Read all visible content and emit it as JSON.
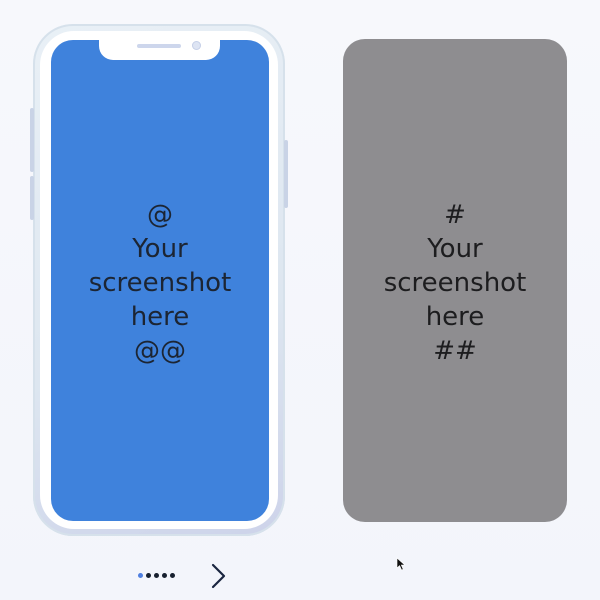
{
  "slides": [
    {
      "lines": [
        "@",
        "Your",
        "screenshot",
        "here",
        "@@"
      ]
    },
    {
      "lines": [
        "#",
        "Your",
        "screenshot",
        "here",
        "##"
      ]
    }
  ],
  "pager": {
    "dot_count": 5,
    "active_index": 0
  },
  "colors": {
    "slide1_bg": "#3f82dc",
    "slide2_bg": "#8e8d90",
    "page_bg": "#f5f7fc",
    "dot": "#17202f",
    "dot_active": "#4f7fe0",
    "arrow": "#1a2540"
  },
  "icons": {
    "next": "chevron-right-icon",
    "cursor": "mouse-pointer-icon"
  }
}
